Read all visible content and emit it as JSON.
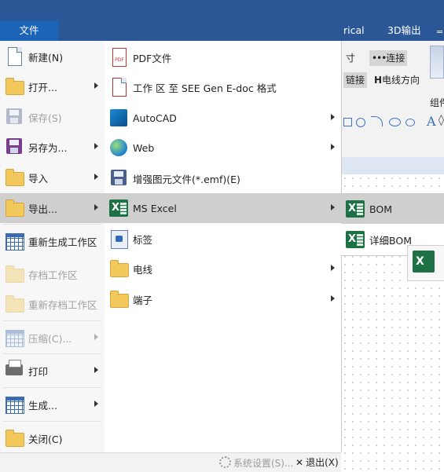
{
  "ribbon": {
    "file_tab": "文件",
    "tabs": [
      "rical",
      "3D输出"
    ],
    "buttons": {
      "size": "寸",
      "connect": "连接",
      "link": "链接",
      "wire_direction": "电线方向",
      "group": "组件"
    }
  },
  "file_menu": {
    "items": [
      {
        "label": "新建(N)",
        "icon": "new-document-icon",
        "disabled": false,
        "submenu": false
      },
      {
        "label": "打开...",
        "icon": "open-folder-icon",
        "disabled": false,
        "submenu": true
      },
      {
        "label": "保存(S)",
        "icon": "save-disk-icon",
        "disabled": true,
        "submenu": false
      },
      {
        "label": "另存为...",
        "icon": "save-as-icon",
        "disabled": false,
        "submenu": true
      },
      {
        "label": "导入",
        "icon": "import-folder-icon",
        "disabled": false,
        "submenu": true
      },
      {
        "label": "导出...",
        "icon": "export-folder-icon",
        "disabled": false,
        "submenu": true,
        "active": true
      },
      {
        "label": "重新生成工作区",
        "icon": "regenerate-workspace-icon",
        "disabled": false,
        "submenu": false
      },
      {
        "label": "存档工作区",
        "icon": "archive-workspace-icon",
        "disabled": true,
        "submenu": false
      },
      {
        "label": "重新存档工作区",
        "icon": "rearchive-workspace-icon",
        "disabled": true,
        "submenu": false
      },
      {
        "label": "压缩(C)...",
        "icon": "compress-icon",
        "disabled": true,
        "submenu": true
      },
      {
        "label": "打印",
        "icon": "printer-icon",
        "disabled": false,
        "submenu": true
      },
      {
        "label": "生成...",
        "icon": "generate-report-icon",
        "disabled": false,
        "submenu": true
      },
      {
        "label": "关闭(C)",
        "icon": "close-folder-icon",
        "disabled": false,
        "submenu": false
      }
    ]
  },
  "export_menu": {
    "items": [
      {
        "label": "PDF文件",
        "icon": "pdf-icon",
        "submenu": false
      },
      {
        "label": "工作 区 至 SEE Gen E-doc 格式",
        "icon": "edoc-document-icon",
        "submenu": false
      },
      {
        "label": "AutoCAD",
        "icon": "autocad-icon",
        "submenu": true
      },
      {
        "label": "Web",
        "icon": "web-globe-icon",
        "submenu": true
      },
      {
        "label": "增强图元文件(*.emf)(E)",
        "icon": "emf-disk-icon",
        "submenu": false
      },
      {
        "label": "MS Excel",
        "icon": "excel-icon",
        "submenu": true,
        "active": true
      },
      {
        "label": "标签",
        "icon": "label-icon",
        "submenu": false
      },
      {
        "label": "电线",
        "icon": "wire-folder-icon",
        "submenu": true
      },
      {
        "label": "端子",
        "icon": "terminal-folder-icon",
        "submenu": true
      }
    ]
  },
  "excel_menu": {
    "items": [
      {
        "label": "BOM",
        "icon": "excel-bom-icon"
      },
      {
        "label": "详细BOM",
        "icon": "excel-detailed-bom-icon"
      }
    ]
  },
  "bottom_bar": {
    "settings": "系统设置(S)...",
    "exit": "退出(X)"
  }
}
